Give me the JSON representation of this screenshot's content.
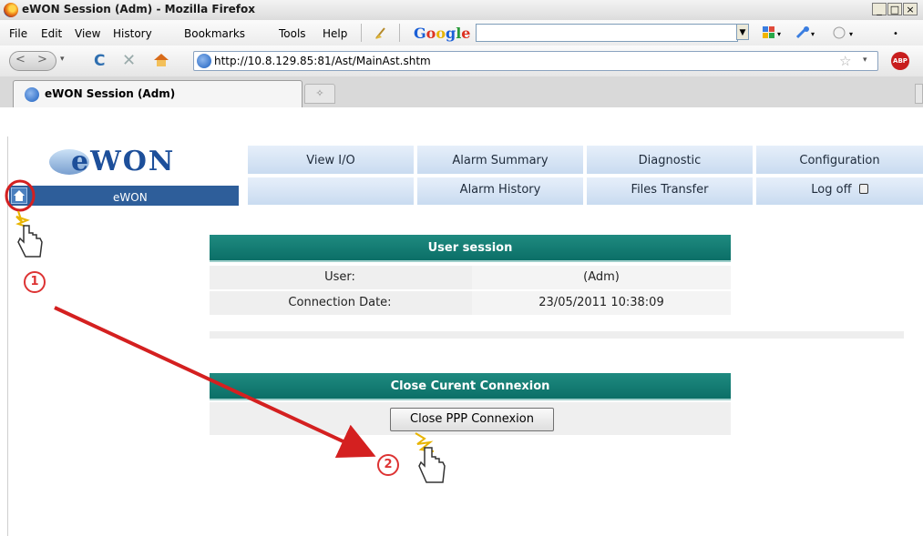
{
  "window": {
    "title": "eWON Session (Adm) - Mozilla Firefox",
    "min": "_",
    "max": "□",
    "close": "×"
  },
  "menu": {
    "file": "File",
    "edit": "Edit",
    "view": "View",
    "history": "History",
    "bookmarks": "Bookmarks",
    "tools": "Tools",
    "help": "Help",
    "google": "Google"
  },
  "nav": {
    "url": "http://10.8.129.85:81/Ast/MainAst.shtm"
  },
  "tab": {
    "title": "eWON Session (Adm)"
  },
  "app": {
    "logo": "eWON",
    "home_label": "eWON",
    "menu_row1": [
      "View I/O",
      "Alarm Summary",
      "Diagnostic",
      "Configuration"
    ],
    "menu_row2": [
      "",
      "Alarm History",
      "Files Transfer",
      "Log off"
    ]
  },
  "session": {
    "header": "User session",
    "user_label": "User:",
    "user_value": "(Adm)",
    "date_label": "Connection Date:",
    "date_value": "23/05/2011 10:38:09"
  },
  "close_panel": {
    "header": "Close Curent Connexion",
    "button": "Close PPP Connexion"
  },
  "annotations": {
    "step1": "1",
    "step2": "2",
    "accent": "#d42020"
  }
}
